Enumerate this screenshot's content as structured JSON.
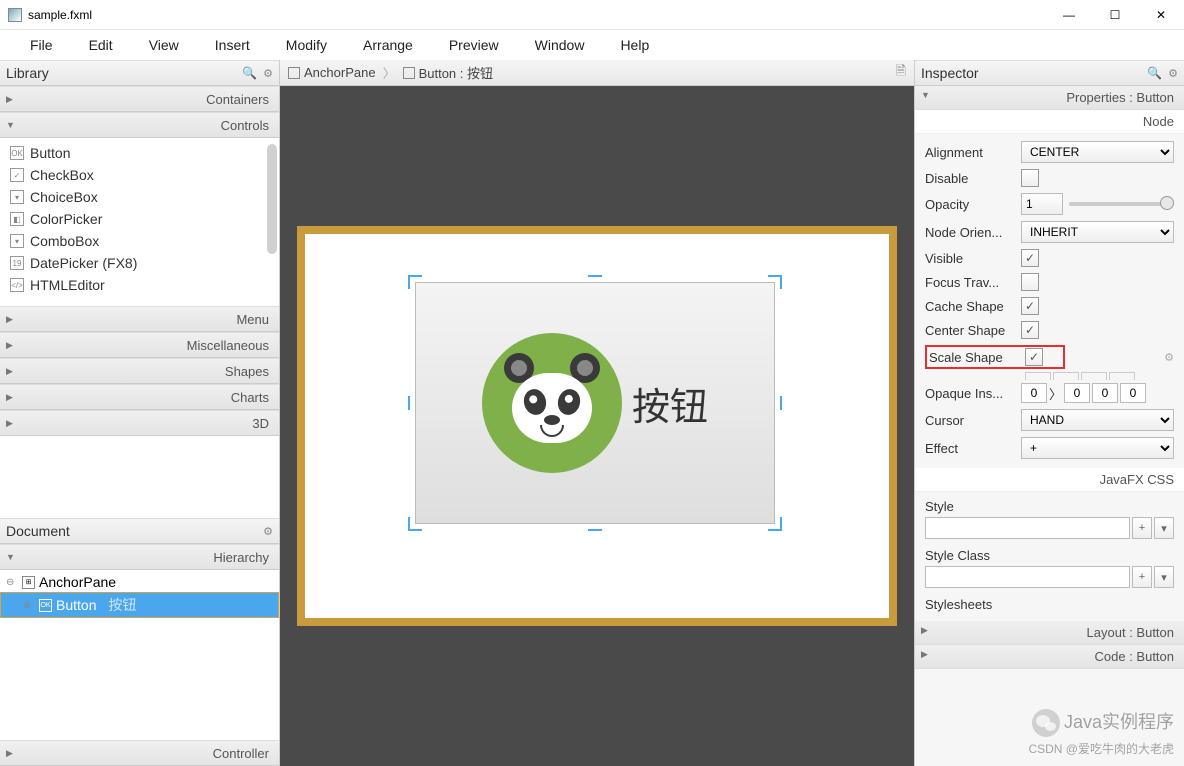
{
  "window": {
    "title": "sample.fxml"
  },
  "menubar": [
    "File",
    "Edit",
    "View",
    "Insert",
    "Modify",
    "Arrange",
    "Preview",
    "Window",
    "Help"
  ],
  "library": {
    "title": "Library",
    "sections": [
      "Containers",
      "Controls",
      "Menu",
      "Miscellaneous",
      "Shapes",
      "Charts",
      "3D"
    ],
    "controls": [
      "Button",
      "CheckBox",
      "ChoiceBox",
      "ColorPicker",
      "ComboBox",
      "DatePicker  (FX8)",
      "HTMLEditor"
    ]
  },
  "document": {
    "title": "Document",
    "sections": [
      "Hierarchy",
      "Controller"
    ],
    "hierarchy": [
      {
        "name": "AnchorPane",
        "selected": false
      },
      {
        "name": "Button",
        "hint": "按钮",
        "selected": true
      }
    ]
  },
  "breadcrumb": {
    "root": "AnchorPane",
    "child": "Button : 按钮"
  },
  "canvas": {
    "button_text": "按钮"
  },
  "inspector": {
    "title": "Inspector",
    "section": "Properties : Button",
    "category": "Node",
    "props": {
      "alignment_label": "Alignment",
      "alignment_value": "CENTER",
      "disable_label": "Disable",
      "disable_value": false,
      "opacity_label": "Opacity",
      "opacity_value": "1",
      "nodeorient_label": "Node Orien...",
      "nodeorient_value": "INHERIT",
      "visible_label": "Visible",
      "visible_value": true,
      "focustrav_label": "Focus Trav...",
      "focustrav_value": false,
      "cacheshape_label": "Cache Shape",
      "cacheshape_value": true,
      "centershape_label": "Center Shape",
      "centershape_value": true,
      "scaleshape_label": "Scale Shape",
      "scaleshape_value": true,
      "opaqueins_label": "Opaque Ins...",
      "opaqueins_values": [
        "0",
        "0",
        "0",
        "0"
      ],
      "cursor_label": "Cursor",
      "cursor_value": "HAND",
      "effect_label": "Effect",
      "effect_value": "+"
    },
    "css_section": "JavaFX CSS",
    "style_label": "Style",
    "styleclass_label": "Style Class",
    "stylesheets_label": "Stylesheets",
    "layout_section": "Layout : Button",
    "code_section": "Code : Button"
  },
  "watermark": {
    "main": "Java实例程序",
    "sub": "CSDN @爱吃牛肉的大老虎"
  }
}
